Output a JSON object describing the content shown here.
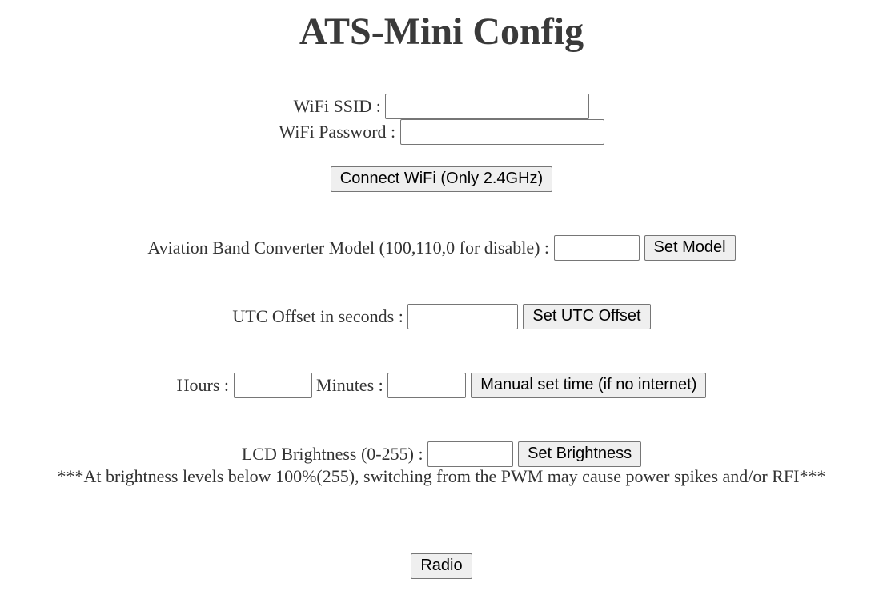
{
  "title": "ATS-Mini Config",
  "wifi": {
    "ssid_label": "WiFi SSID :",
    "ssid_value": "",
    "password_label": "WiFi Password :",
    "password_value": "",
    "connect_label": "Connect WiFi (Only 2.4GHz)"
  },
  "aviation": {
    "label": "Aviation Band Converter Model (100,110,0 for disable) :",
    "value": "",
    "button_label": "Set Model"
  },
  "utc": {
    "label": "UTC Offset in seconds :",
    "value": "",
    "button_label": "Set UTC Offset"
  },
  "manual_time": {
    "hours_label": "Hours :",
    "hours_value": "",
    "minutes_label": "Minutes :",
    "minutes_value": "",
    "button_label": "Manual set time (if no internet)"
  },
  "brightness": {
    "label": "LCD Brightness (0-255) :",
    "value": "",
    "button_label": "Set Brightness",
    "warning": "***At brightness levels below 100%(255), switching from the PWM may cause power spikes and/or RFI***"
  },
  "radio_button_label": "Radio"
}
